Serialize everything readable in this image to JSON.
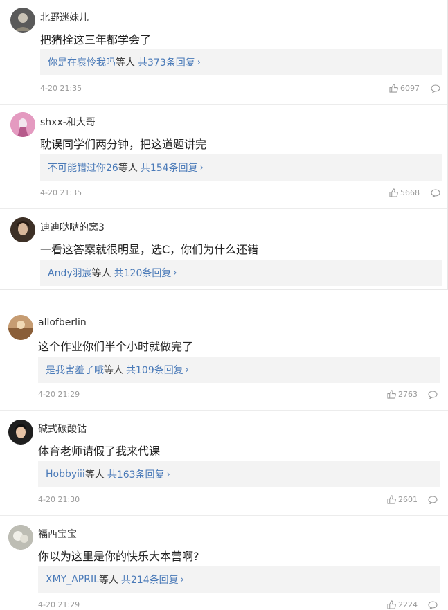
{
  "comments": [
    {
      "username": "北野迷妹儿",
      "text": "把猪拴这三年都学会了",
      "reply_users": "你是在哀怜我吗",
      "reply_mid": "等人",
      "reply_count": "共373条回复",
      "time": "4-20 21:35",
      "likes": "6097",
      "avatar_color": "#6b6b6b"
    },
    {
      "username": "shxx-和大哥",
      "text": "耽误同学们两分钟，把这道题讲完",
      "reply_users": "不可能错过你26",
      "reply_mid": "等人",
      "reply_count": "共154条回复",
      "time": "4-20 21:35",
      "likes": "5668",
      "avatar_color": "#d37aa8"
    },
    {
      "username": "迪迪哒哒的窝3",
      "text": "一看这答案就很明显，选C，你们为什么还错",
      "reply_users": "Andy羽宸",
      "reply_mid": "等人",
      "reply_count": "共120条回复",
      "avatar_color": "#4a3a2e"
    },
    {
      "username": "allofberlin",
      "text": "这个作业你们半个小时就做完了",
      "reply_users": "是我害羞了哦",
      "reply_mid": "等人",
      "reply_count": "共109条回复",
      "time": "4-20 21:29",
      "likes": "2763",
      "avatar_color": "#b98a5b"
    },
    {
      "username": "碱式碳酸钴",
      "text": "体育老师请假了我来代课",
      "reply_users": "Hobbyiii",
      "reply_mid": "等人",
      "reply_count": "共163条回复",
      "time": "4-20 21:30",
      "likes": "2601",
      "avatar_color": "#2b2b2b"
    },
    {
      "username": "福西宝宝",
      "text": "你以为这里是你的快乐大本营啊?",
      "reply_users": "XMY_APRIL",
      "reply_mid": "等人",
      "reply_count": "共214条回复",
      "time": "4-20 21:29",
      "likes": "2224",
      "avatar_color": "#9a9a92"
    }
  ]
}
